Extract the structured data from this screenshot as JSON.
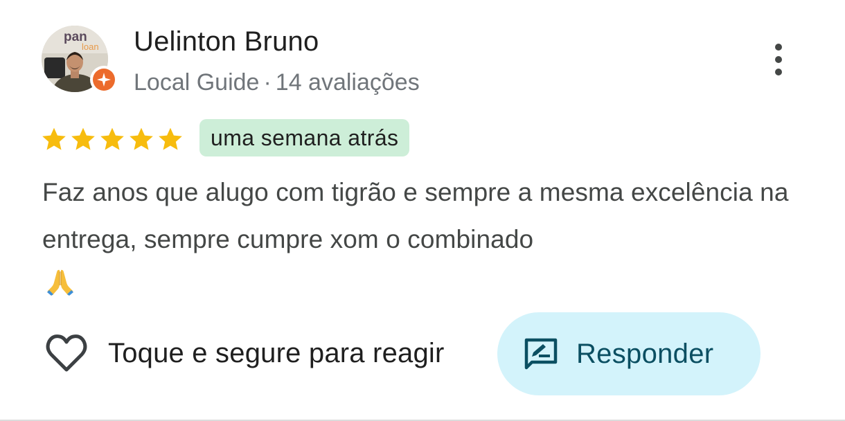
{
  "review": {
    "reviewer_name": "Uelinton Bruno",
    "reviewer_badge": "Local Guide",
    "separator": "·",
    "review_count": "14 avaliações",
    "avatar_sign_text": "pan",
    "avatar_sign_text2": "loan",
    "rating": 5,
    "rating_max": 5,
    "time_ago": "uma semana atrás",
    "text": "Faz anos que alugo com tigrão e sempre a mesma excelência na entrega, sempre cumpre xom o combinado",
    "emoji_icon": "folded-hands-emoji"
  },
  "actions": {
    "react_label": "Toque e segure para reagir",
    "reply_label": "Responder"
  },
  "colors": {
    "star": "#f7bc0e",
    "time_badge_bg": "#cdeed8",
    "local_guide_badge": "#ec6b2c",
    "reply_bg": "#d3f3fb",
    "reply_text": "#0b4f62"
  },
  "icons": {
    "more": "more-vert-icon",
    "heart": "heart-outline-icon",
    "reply": "rate-review-icon",
    "guide": "local-guide-star-icon"
  }
}
